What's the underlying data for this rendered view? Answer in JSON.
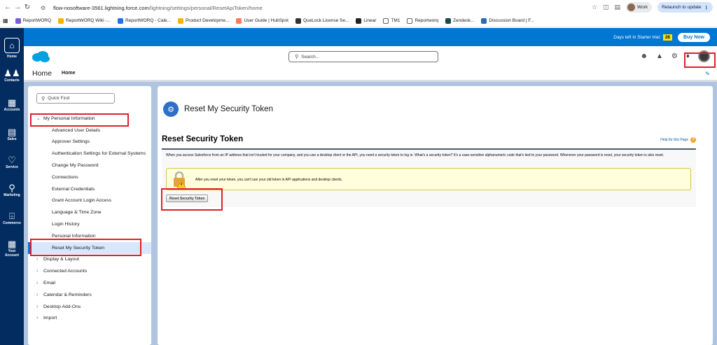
{
  "browser": {
    "url_host": "flow-nosoftware-3561.lightning.force.com",
    "url_path": "/lightning/settings/personal/ResetApiToken/home",
    "profile_label": "Work",
    "relaunch_label": "Relaunch to update"
  },
  "bookmarks": [
    {
      "label": "ReportWORQ",
      "color": "#7b5cd6"
    },
    {
      "label": "ReportWORQ Wiki -...",
      "color": "#f4b400"
    },
    {
      "label": "ReportWORQ - Cale...",
      "color": "#1a73e8"
    },
    {
      "label": "Product Developme...",
      "color": "#f4b400"
    },
    {
      "label": "User Guide | HubSpot",
      "color": "#ff7a59"
    },
    {
      "label": "QueLock License Se...",
      "color": "#333333"
    },
    {
      "label": "Linear",
      "color": "#222222"
    },
    {
      "label": "TM1",
      "color": "#5f6368"
    },
    {
      "label": "Reportworq",
      "color": "#5f6368"
    },
    {
      "label": "Zendesk...",
      "color": "#17494d"
    },
    {
      "label": "Discussion Board | F...",
      "color": "#2b6cb0"
    }
  ],
  "rail": {
    "items": [
      {
        "label": "Home",
        "icon": "home-icon"
      },
      {
        "label": "Contacts",
        "icon": "contacts-icon"
      },
      {
        "label": "Accounts",
        "icon": "accounts-icon"
      },
      {
        "label": "Sales",
        "icon": "sales-icon"
      },
      {
        "label": "Service",
        "icon": "service-icon"
      },
      {
        "label": "Marketing",
        "icon": "marketing-icon"
      },
      {
        "label": "Commerce",
        "icon": "commerce-icon"
      },
      {
        "label": "Your Account",
        "icon": "your-account-icon"
      }
    ]
  },
  "banner": {
    "trial_text": "Days left in Starter trial:",
    "trial_days": "26",
    "buy_now": "Buy Now"
  },
  "header": {
    "search_placeholder": "Search..."
  },
  "navbar": {
    "app_name": "Home",
    "tab_home": "Home"
  },
  "sidebar": {
    "quick_find_placeholder": "Quick Find",
    "tree": [
      {
        "label": "My Personal Information",
        "level": "top",
        "expanded": true
      },
      {
        "label": "Advanced User Details",
        "level": "sub"
      },
      {
        "label": "Approver Settings",
        "level": "sub"
      },
      {
        "label": "Authentication Settings for External Systems",
        "level": "sub"
      },
      {
        "label": "Change My Password",
        "level": "sub"
      },
      {
        "label": "Connections",
        "level": "sub"
      },
      {
        "label": "External Credentials",
        "level": "sub"
      },
      {
        "label": "Grant Account Login Access",
        "level": "sub"
      },
      {
        "label": "Language & Time Zone",
        "level": "sub"
      },
      {
        "label": "Login History",
        "level": "sub"
      },
      {
        "label": "Personal Information",
        "level": "sub"
      },
      {
        "label": "Reset My Security Token",
        "level": "sub",
        "selected": true
      },
      {
        "label": "Display & Layout",
        "level": "top"
      },
      {
        "label": "Connected Accounts",
        "level": "top"
      },
      {
        "label": "Email",
        "level": "top"
      },
      {
        "label": "Calendar & Reminders",
        "level": "top"
      },
      {
        "label": "Desktop Add-Ons",
        "level": "top"
      },
      {
        "label": "Import",
        "level": "top"
      }
    ]
  },
  "main": {
    "page_header_title": "Reset My Security Token",
    "content_title": "Reset Security Token",
    "help_link": "Help for this Page",
    "description": "When you access Salesforce from an IP address that isn't trusted for your company, and you use a desktop client or the API, you need a security token to log in. What's a security token? It's a case-sensitive alphanumeric code that's tied to your password. Whenever your password is reset, your security token is also reset.",
    "warning_text": "After you reset your token, you can't use your old token in API applications and desktop clients.",
    "reset_button": "Reset Security Token"
  },
  "colors": {
    "brand_blue": "#0176d3",
    "rail_navy": "#032d60",
    "annotation_red": "#e01f28"
  }
}
